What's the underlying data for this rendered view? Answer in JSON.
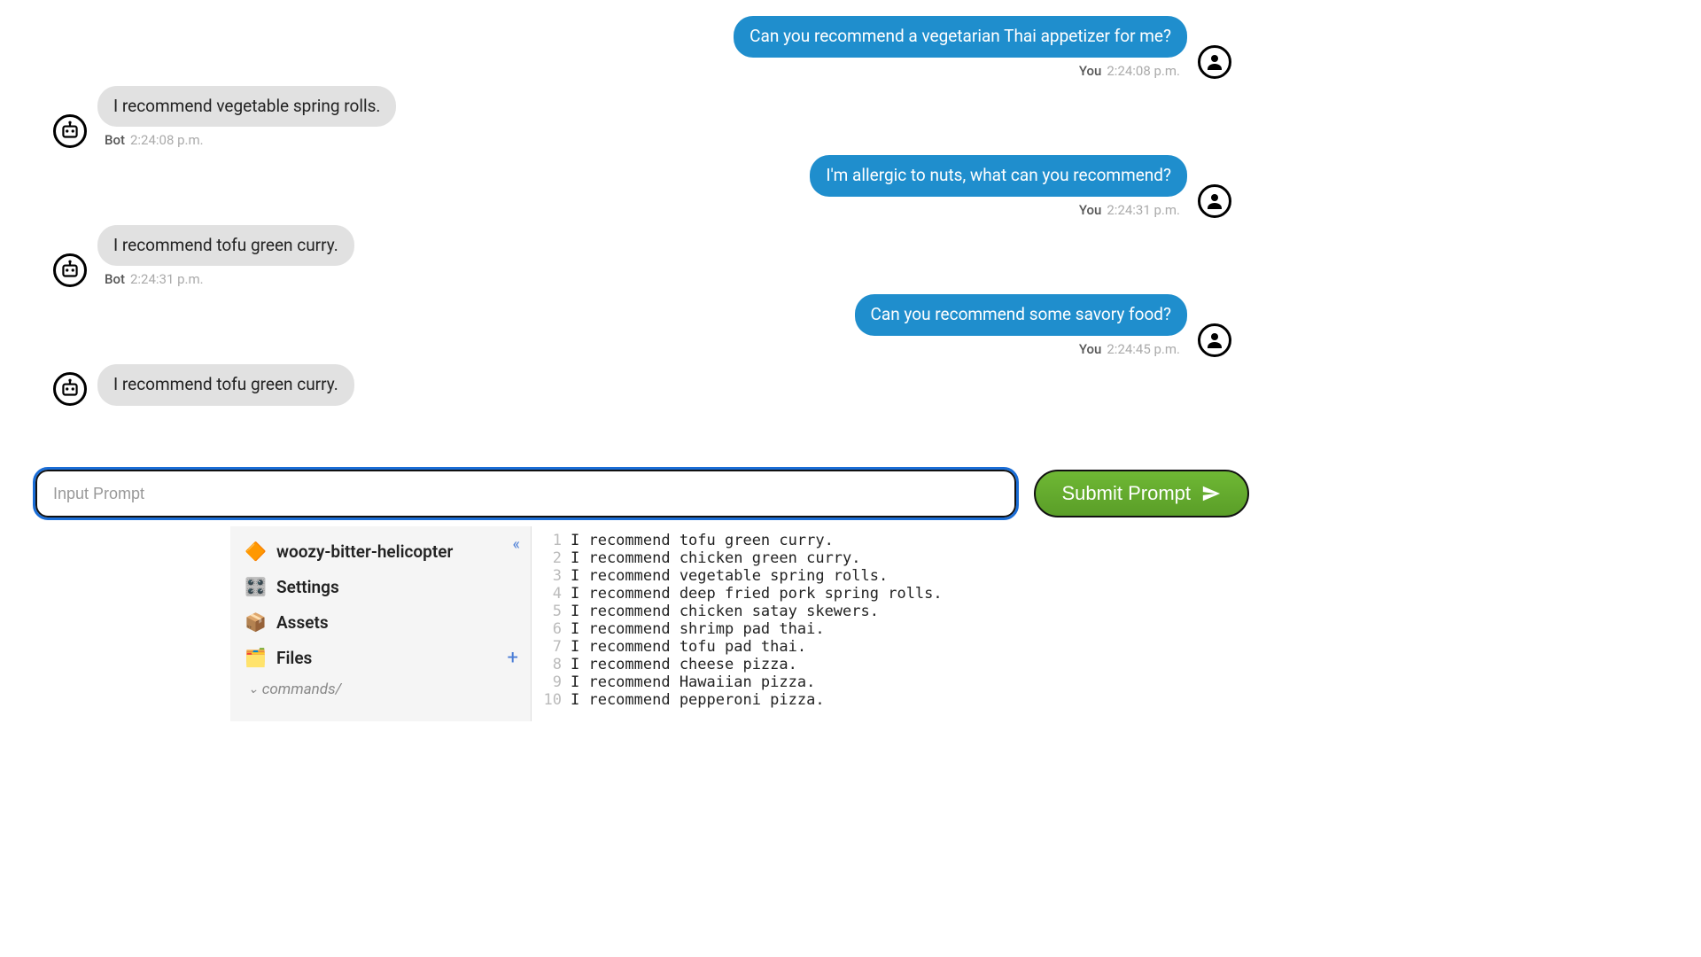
{
  "chat": {
    "user_label": "You",
    "bot_label": "Bot",
    "messages": [
      {
        "role": "user",
        "text": "Can you recommend a vegetarian Thai appetizer for me?",
        "time": "2:24:08 p.m."
      },
      {
        "role": "bot",
        "text": "I recommend vegetable spring rolls.",
        "time": "2:24:08 p.m."
      },
      {
        "role": "user",
        "text": "I'm allergic to nuts, what can you recommend?",
        "time": "2:24:31 p.m."
      },
      {
        "role": "bot",
        "text": "I recommend tofu green curry.",
        "time": "2:24:31 p.m."
      },
      {
        "role": "user",
        "text": "Can you recommend some savory food?",
        "time": "2:24:45 p.m."
      },
      {
        "role": "bot",
        "text": "I recommend tofu green curry.",
        "time": ""
      }
    ]
  },
  "input": {
    "placeholder": "Input Prompt",
    "submit_label": "Submit Prompt"
  },
  "sidebar": {
    "project": "woozy-bitter-helicopter",
    "items": [
      {
        "icon": "⚙️",
        "label": "Settings"
      },
      {
        "icon": "📦",
        "label": "Assets"
      },
      {
        "icon": "🗂️",
        "label": "Files"
      }
    ],
    "folder": "commands/"
  },
  "code": {
    "lines": [
      "I recommend tofu green curry.",
      "I recommend chicken green curry.",
      "I recommend vegetable spring rolls.",
      "I recommend deep fried pork spring rolls.",
      "I recommend chicken satay skewers.",
      "I recommend shrimp pad thai.",
      "I recommend tofu pad thai.",
      "I recommend cheese pizza.",
      "I recommend Hawaiian pizza.",
      "I recommend pepperoni pizza."
    ]
  }
}
